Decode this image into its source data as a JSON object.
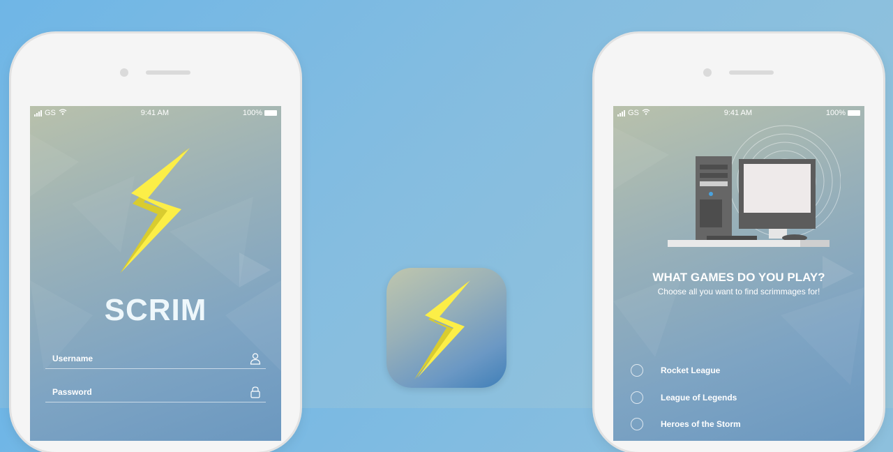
{
  "status_bar": {
    "carrier": "GS",
    "time": "9:41 AM",
    "battery": "100%"
  },
  "login_screen": {
    "app_name": "SCRIM",
    "username_label": "Username",
    "password_label": "Password"
  },
  "games_screen": {
    "heading": "WHAT GAMES DO YOU PLAY?",
    "subheading": "Choose all you want to find scrimmages for!",
    "options": [
      {
        "label": "Rocket League"
      },
      {
        "label": "League of Legends"
      },
      {
        "label": "Heroes of the Storm"
      }
    ]
  },
  "colors": {
    "bolt_light": "#fff04a",
    "bolt_dark": "#e3d436",
    "background": "#7fbbe3"
  },
  "icons": [
    "lightning-bolt",
    "user-icon",
    "lock-icon",
    "computer-illustration"
  ]
}
